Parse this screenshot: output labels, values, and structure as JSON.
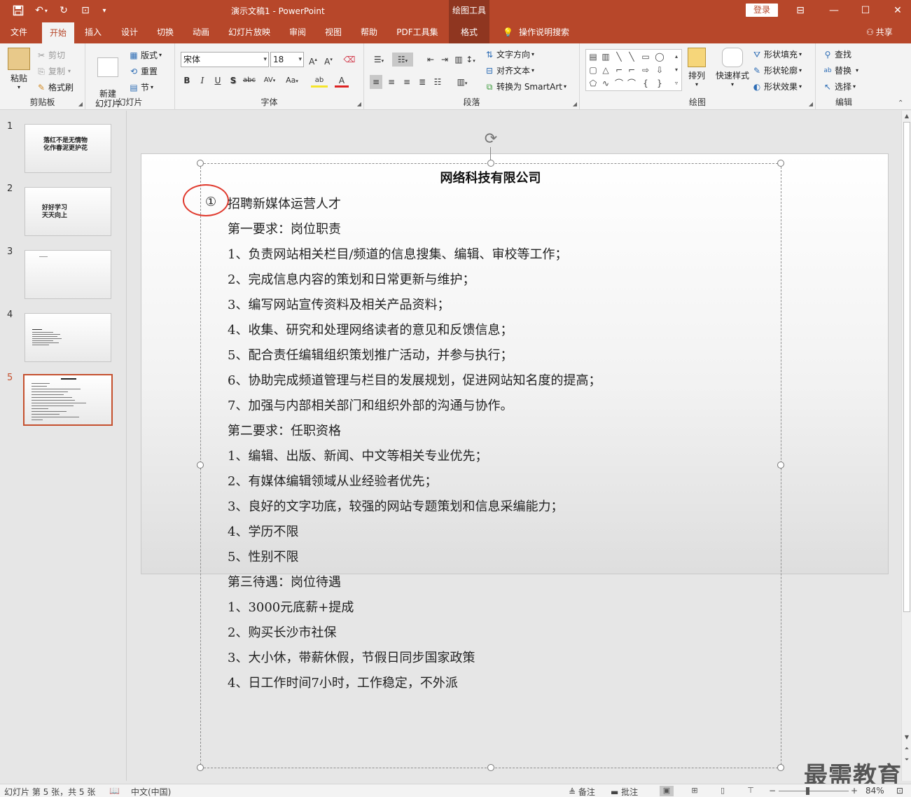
{
  "app": {
    "document_title": "演示文稿1 - PowerPoint",
    "context_tool": "绘图工具",
    "login_label": "登录"
  },
  "quick_access": [
    "save-icon",
    "undo-icon",
    "redo-icon",
    "start-slideshow-icon",
    "customize-icon"
  ],
  "tabs": [
    {
      "label": "文件"
    },
    {
      "label": "开始"
    },
    {
      "label": "插入"
    },
    {
      "label": "设计"
    },
    {
      "label": "切换"
    },
    {
      "label": "动画"
    },
    {
      "label": "幻灯片放映"
    },
    {
      "label": "审阅"
    },
    {
      "label": "视图"
    },
    {
      "label": "帮助"
    },
    {
      "label": "PDF工具集"
    },
    {
      "label": "格式"
    }
  ],
  "tell_me": "操作说明搜索",
  "share": "共享",
  "ribbon": {
    "clipboard": {
      "label": "剪贴板",
      "paste": "粘贴",
      "cut": "剪切",
      "copy": "复制",
      "format_painter": "格式刷"
    },
    "slides": {
      "label": "幻灯片",
      "new_slide": "新建\n幻灯片",
      "layout": "版式",
      "reset": "重置",
      "section": "节"
    },
    "font": {
      "label": "字体",
      "font_name": "宋体",
      "font_size": "18",
      "bold": "B",
      "italic": "I",
      "underline": "U",
      "shadow": "S",
      "strike": "abc",
      "spacing": "AV",
      "case": "Aa"
    },
    "paragraph": {
      "label": "段落",
      "text_direction": "文字方向",
      "align_text": "对齐文本",
      "smartart": "转换为 SmartArt"
    },
    "drawing": {
      "label": "绘图",
      "arrange": "排列",
      "quick_styles": "快速样式",
      "shape_fill": "形状填充",
      "shape_outline": "形状轮廓",
      "shape_effects": "形状效果"
    },
    "editing": {
      "label": "编辑",
      "find": "查找",
      "replace": "替换",
      "select": "选择"
    }
  },
  "thumbnails": [
    {
      "num": "1",
      "text": "落红不是无情物\n化作春泥更护花"
    },
    {
      "num": "2",
      "text": "好好学习\n天天向上"
    },
    {
      "num": "3",
      "text": ""
    },
    {
      "num": "4",
      "text": ""
    },
    {
      "num": "5",
      "text": ""
    }
  ],
  "slide": {
    "heading": "网络科技有限公司",
    "circled_marker": "①",
    "lines": [
      "招聘新媒体运营人才",
      "第一要求：岗位职责",
      "1、负责网站相关栏目/频道的信息搜集、编辑、审校等工作；",
      "2、完成信息内容的策划和日常更新与维护；",
      "3、编写网站宣传资料及相关产品资料；",
      "4、收集、研究和处理网络读者的意见和反馈信息；",
      "5、配合责任编辑组织策划推广活动，并参与执行；",
      "6、协助完成频道管理与栏目的发展规划，促进网站知名度的提高；",
      "7、加强与内部相关部门和组织外部的沟通与协作。",
      "第二要求：任职资格",
      "1、编辑、出版、新闻、中文等相关专业优先；",
      "2、有媒体编辑领域从业经验者优先；",
      "3、良好的文字功底，较强的网站专题策划和信息采编能力；",
      "4、学历不限",
      "5、性别不限",
      "第三待遇：岗位待遇",
      "1、3000元底薪+提成",
      "2、购买长沙市社保",
      "3、大小休，带薪休假，节假日同步国家政策",
      "4、日工作时间7小时，工作稳定，不外派"
    ]
  },
  "watermark": "最需教育",
  "status": {
    "slide_info": "幻灯片 第 5 张，共 5 张",
    "language": "中文(中国)",
    "notes": "备注",
    "comments": "批注",
    "zoom": "84%"
  }
}
